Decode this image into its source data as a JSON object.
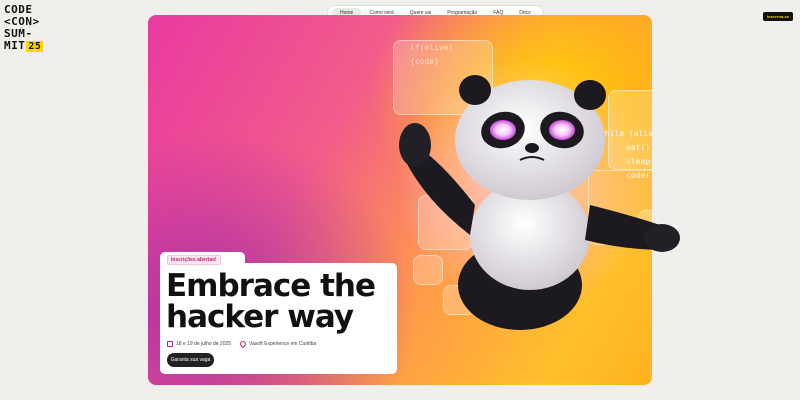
{
  "logo": {
    "lines": [
      "CODE",
      "<CON>",
      "SUM-",
      "MIT"
    ],
    "year": "25"
  },
  "nav": {
    "items": [
      {
        "label": "Home",
        "active": true
      },
      {
        "label": "Como será",
        "active": false
      },
      {
        "label": "Quem vai",
        "active": false
      },
      {
        "label": "Programação",
        "active": false
      },
      {
        "label": "FAQ",
        "active": false
      },
      {
        "label": "Docs",
        "active": false
      }
    ]
  },
  "header_button": {
    "label": "Inscreva-se"
  },
  "hero": {
    "badge": "Inscrições abertas!",
    "headline_line1": "Embrace the",
    "headline_line2": "hacker way",
    "date": "18 e 19 de julho de 2025",
    "location": "Vasoft Experience em Curitiba",
    "cta": "Garanta sua vaga",
    "code_lines": [
      "while (alive) {",
      "eat()",
      "sleep()",
      "code()"
    ],
    "code_faint": [
      "if(alive)",
      "{code}"
    ]
  },
  "colors": {
    "accent": "#ffd400",
    "brand_pink": "#e93aa0",
    "badge_text": "#c81e7a"
  },
  "icons": {
    "date": "calendar-icon",
    "location": "map-pin-icon"
  }
}
